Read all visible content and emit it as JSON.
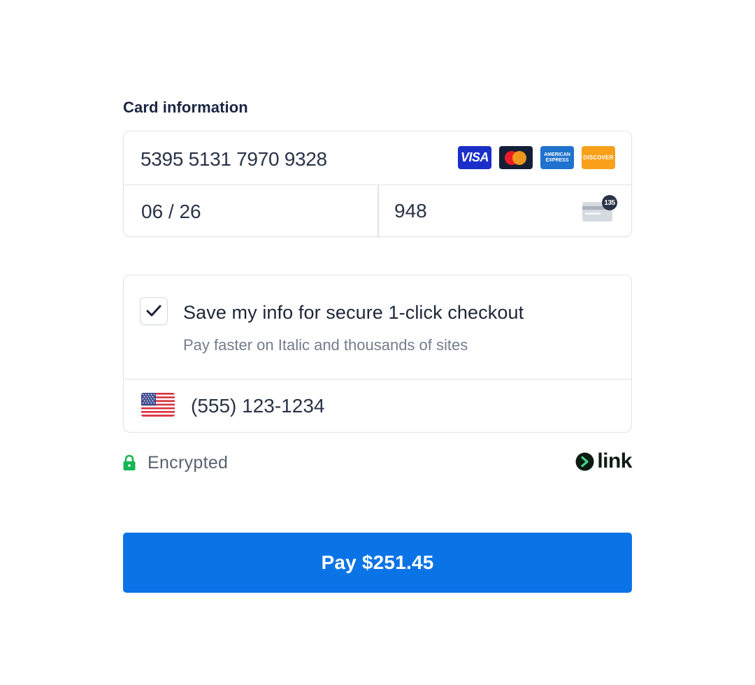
{
  "form": {
    "section_label": "Card information",
    "card_number": "5395 5131 7970 9328",
    "expiry": "06 / 26",
    "cvc": "948",
    "cvc_badge": "135",
    "brands": {
      "visa": "VISA",
      "amex_line1": "AMERICAN",
      "amex_line2": "EXPRESS",
      "discover": "DISCOVER"
    }
  },
  "save_info": {
    "checked": true,
    "title": "Save my info for secure 1-click checkout",
    "subtitle": "Pay faster on Italic and thousands of sites",
    "phone": "(555) 123-1234",
    "flag_icon": "us-flag-icon"
  },
  "footer": {
    "encrypted_label": "Encrypted",
    "link_label": "link"
  },
  "pay_button": {
    "label": "Pay $251.45"
  },
  "colors": {
    "accent": "#0a74e6",
    "lock": "#16b553",
    "border": "#dfe3ea"
  }
}
